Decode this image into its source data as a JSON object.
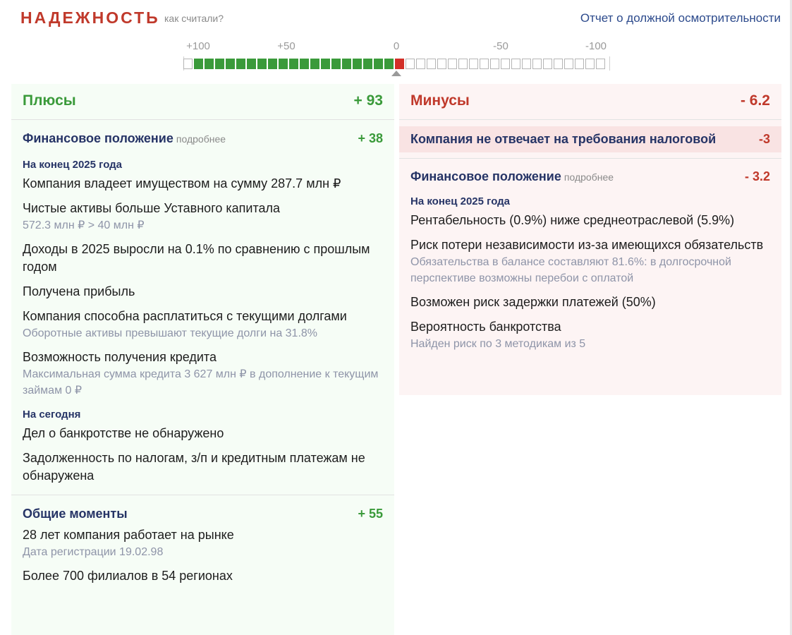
{
  "header": {
    "title": "НАДЕЖНОСТЬ",
    "how_link": "как считали?",
    "report_link": "Отчет о должной осмотрительности"
  },
  "scale": {
    "labels": [
      "+100",
      "+50",
      "0",
      "-50",
      "-100"
    ],
    "score_plus": 93,
    "score_minus": -6.2,
    "colors": {
      "positive": "#3a9a3a",
      "negative": "#d22f27",
      "empty": "#ffffff"
    }
  },
  "plus": {
    "label": "Плюсы",
    "score": "+ 93",
    "financial": {
      "title": "Финансовое положение",
      "more": "подробнее",
      "score": "+ 38",
      "period1": "На конец 2025 года",
      "items1": [
        {
          "main": "Компания владеет имуществом на сумму 287.7 млн ₽",
          "note": ""
        },
        {
          "main": "Чистые активы больше Уставного капитала",
          "note": "572.3 млн ₽ > 40 млн ₽"
        },
        {
          "main": "Доходы в 2025 выросли на 0.1% по сравнению с прошлым годом",
          "note": ""
        },
        {
          "main": "Получена прибыль",
          "note": ""
        },
        {
          "main": "Компания способна расплатиться с текущими долгами",
          "note": "Оборотные активы превышают текущие долги на 31.8%"
        },
        {
          "main": "Возможность получения кредита",
          "note": "Максимальная сумма кредита 3 627 млн ₽ в дополнение к текущим займам 0 ₽"
        }
      ],
      "period2": "На сегодня",
      "items2": [
        {
          "main": "Дел о банкротстве не обнаружено",
          "note": ""
        },
        {
          "main": "Задолженность по налогам, з/п и кредитным платежам не обнаружена",
          "note": ""
        }
      ]
    },
    "general": {
      "title": "Общие моменты",
      "score": "+ 55",
      "items": [
        {
          "main": "28 лет компания работает на рынке",
          "note": "Дата регистрации 19.02.98"
        },
        {
          "main": "Более 700 филиалов в 54 регионах",
          "note": ""
        }
      ]
    }
  },
  "minus": {
    "label": "Минусы",
    "score": "- 6.2",
    "tax": {
      "title": "Компания не отвечает на требования налоговой",
      "score": "-3"
    },
    "financial": {
      "title": "Финансовое положение",
      "more": "подробнее",
      "score": "- 3.2",
      "period": "На конец 2025 года",
      "items": [
        {
          "main": "Рентабельность (0.9%) ниже среднеотраслевой (5.9%)",
          "note": ""
        },
        {
          "main": "Риск потери независимости из-за имеющихся обязательств",
          "note": "Обязательства в балансе составляют 81.6%: в долгосрочной перспективе возможны перебои с оплатой"
        },
        {
          "main": "Возможен риск задержки платежей (50%)",
          "note": ""
        },
        {
          "main": "Вероятность банкротства",
          "note": "Найден риск по 3 методикам из 5"
        }
      ]
    }
  }
}
